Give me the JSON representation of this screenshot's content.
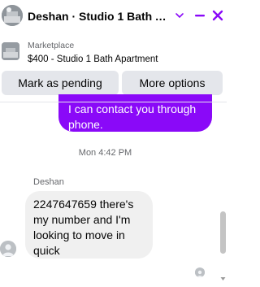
{
  "header": {
    "title": "Deshan · Studio 1 Bath Ap···",
    "avatar_icon": "listing-photo-avatar",
    "chevron_icon": "chevron-down-icon",
    "minimize_icon": "minimize-icon",
    "close_icon": "close-icon"
  },
  "marketplace": {
    "source": "Marketplace",
    "listing": "$400 - Studio 1 Bath Apartment",
    "thumb_icon": "listing-thumbnail"
  },
  "actions": {
    "pending_label": "Mark as pending",
    "options_label": "More options"
  },
  "messages": {
    "outgoing_text": "I can contact you through phone.",
    "timestamp": "Mon 4:42 PM",
    "sender_name": "Deshan",
    "incoming_text": "2247647659 there's my number and I'm looking to move in quick"
  },
  "colors": {
    "accent": "#8a09f8",
    "outgoing_bubble": "#8a09f8",
    "incoming_bubble": "#f0f0f0",
    "button_bg": "#e4e6eb"
  }
}
